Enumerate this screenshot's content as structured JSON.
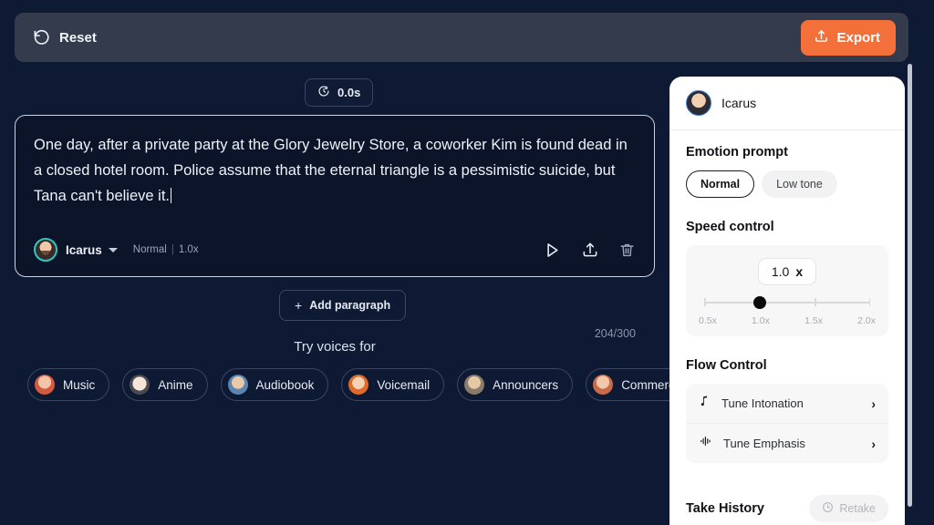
{
  "topbar": {
    "reset_label": "Reset",
    "reset_icon": "rotate-ccw-icon",
    "export_label": "Export",
    "export_icon": "upload-icon",
    "export_color": "#f4703a",
    "background": "#333b4d"
  },
  "timer": {
    "value": "0.0s",
    "icon": "timer-icon"
  },
  "paragraph": {
    "text": "One day, after a private party at the Glory Jewelry Store, a coworker Kim is found dead in a closed hotel room. Police assume that the eternal triangle is a pessimistic suicide, but Tana can't believe it.",
    "char_count": "204/300",
    "speaker": "Icarus",
    "emotion": "Normal",
    "speed": "1.0x",
    "separator": "|",
    "actions": [
      {
        "name": "play-icon",
        "label": "Play"
      },
      {
        "name": "upload-icon",
        "label": "Export"
      },
      {
        "name": "trash-icon",
        "label": "Delete"
      }
    ]
  },
  "add_paragraph": {
    "plus": "+",
    "label": "Add paragraph"
  },
  "try_voices": {
    "title": "Try voices for",
    "chips": [
      {
        "label": "Music",
        "avatar": "#d4593f"
      },
      {
        "label": "Anime",
        "avatar": "#e8d7c8"
      },
      {
        "label": "Audiobook",
        "avatar": "#5c84b0"
      },
      {
        "label": "Voicemail",
        "avatar": "#e06a2a"
      },
      {
        "label": "Announcers",
        "avatar": "#8a7a6a"
      },
      {
        "label": "Commercial",
        "avatar": "#c96a4a"
      }
    ]
  },
  "panel": {
    "speaker_name": "Icarus",
    "emotion": {
      "title": "Emotion prompt",
      "options": [
        {
          "label": "Normal",
          "selected": true
        },
        {
          "label": "Low tone",
          "selected": false
        }
      ]
    },
    "speed": {
      "title": "Speed control",
      "value": "1.0",
      "unit": "x",
      "ticks": [
        "0.5x",
        "1.0x",
        "1.5x",
        "2.0x"
      ],
      "thumb_percent": 33.3
    },
    "flow": {
      "title": "Flow Control",
      "rows": [
        {
          "label": "Tune Intonation",
          "icon": "music-note-icon"
        },
        {
          "label": "Tune Emphasis",
          "icon": "waveform-icon"
        }
      ],
      "chevron": "›"
    },
    "take_history": {
      "title": "Take History",
      "retake_label": "Retake",
      "retake_icon": "refresh-icon"
    }
  }
}
